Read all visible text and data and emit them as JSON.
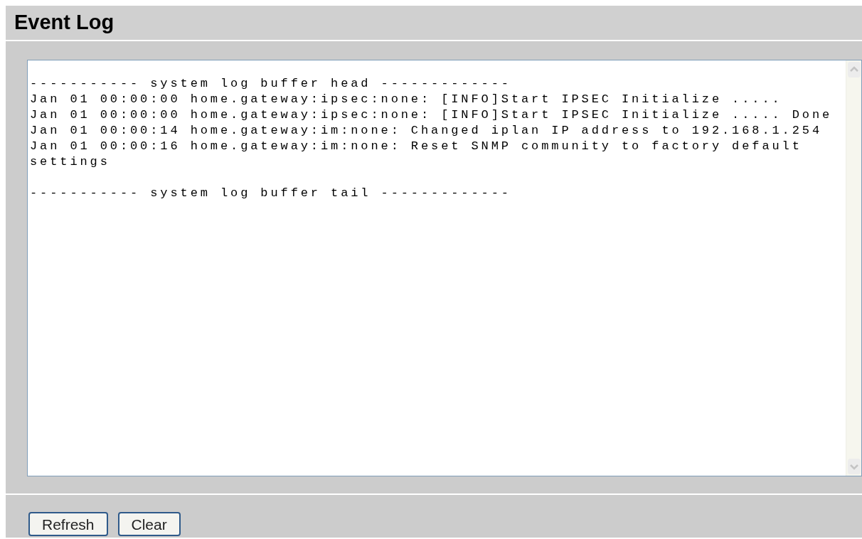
{
  "header": {
    "title": "Event Log"
  },
  "log": {
    "buffer_head": "----------- system log buffer head -------------",
    "entries": [
      "Jan 01 00:00:00 home.gateway:ipsec:none: [INFO]Start IPSEC Initialize .....",
      "Jan 01 00:00:00 home.gateway:ipsec:none: [INFO]Start IPSEC Initialize ..... Done",
      "Jan 01 00:00:14 home.gateway:im:none: Changed iplan IP address to 192.168.1.254",
      "Jan 01 00:00:16 home.gateway:im:none: Reset SNMP community to factory default settings"
    ],
    "buffer_tail": "----------- system log buffer tail -------------"
  },
  "buttons": [
    "Refresh",
    "Clear"
  ]
}
